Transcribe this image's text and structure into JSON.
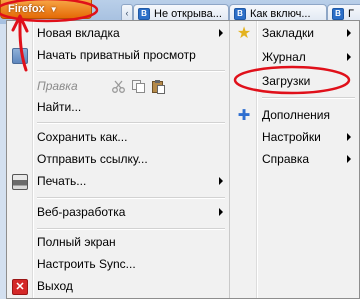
{
  "toolbar": {
    "firefox_button": "Firefox",
    "tabs": [
      {
        "label": "Не открыва..."
      },
      {
        "label": "Как включ..."
      },
      {
        "label": "Г"
      }
    ]
  },
  "menu": {
    "left": [
      {
        "label": "Новая вкладка"
      },
      {
        "label": "Начать приватный просмотр"
      },
      {
        "label": "Правка"
      },
      {
        "label": "Найти..."
      },
      {
        "label": "Сохранить как..."
      },
      {
        "label": "Отправить ссылку..."
      },
      {
        "label": "Печать..."
      },
      {
        "label": "Веб-разработка"
      },
      {
        "label": "Полный экран"
      },
      {
        "label": "Настроить Sync..."
      },
      {
        "label": "Выход"
      }
    ],
    "right": [
      {
        "label": "Закладки"
      },
      {
        "label": "Журнал"
      },
      {
        "label": "Загрузки"
      },
      {
        "label": "Дополнения"
      },
      {
        "label": "Настройки"
      },
      {
        "label": "Справка"
      }
    ]
  },
  "colors": {
    "firefox_orange": "#e46a06",
    "annotation_red": "#e0101a",
    "menu_background": "#f1f1f1"
  },
  "icons": [
    "private-browsing-icon",
    "cut-icon",
    "copy-icon",
    "paste-icon",
    "print-icon",
    "exit-icon",
    "bookmark-star-icon",
    "addons-puzzle-icon"
  ]
}
